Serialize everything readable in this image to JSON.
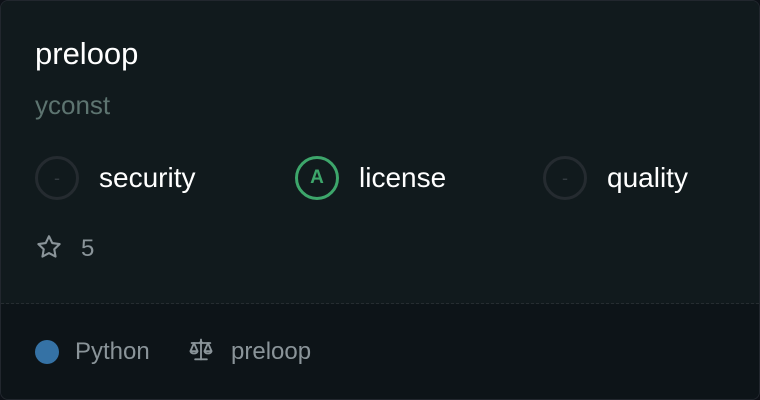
{
  "repo": {
    "name": "preloop",
    "owner": "yconst"
  },
  "metrics": [
    {
      "grade": "-",
      "label": "security",
      "icon": "security-grade-circle",
      "color": "#252b30"
    },
    {
      "grade": "A",
      "label": "license",
      "icon": "license-grade-circle",
      "color": "#3da66b"
    },
    {
      "grade": "-",
      "label": "quality",
      "icon": "quality-grade-circle",
      "color": "#252b30"
    }
  ],
  "stars": {
    "icon": "star-icon",
    "count": "5"
  },
  "footer": {
    "language": {
      "name": "Python",
      "color": "#3572a5"
    },
    "license": {
      "icon": "scale-icon",
      "name": "preloop"
    }
  }
}
